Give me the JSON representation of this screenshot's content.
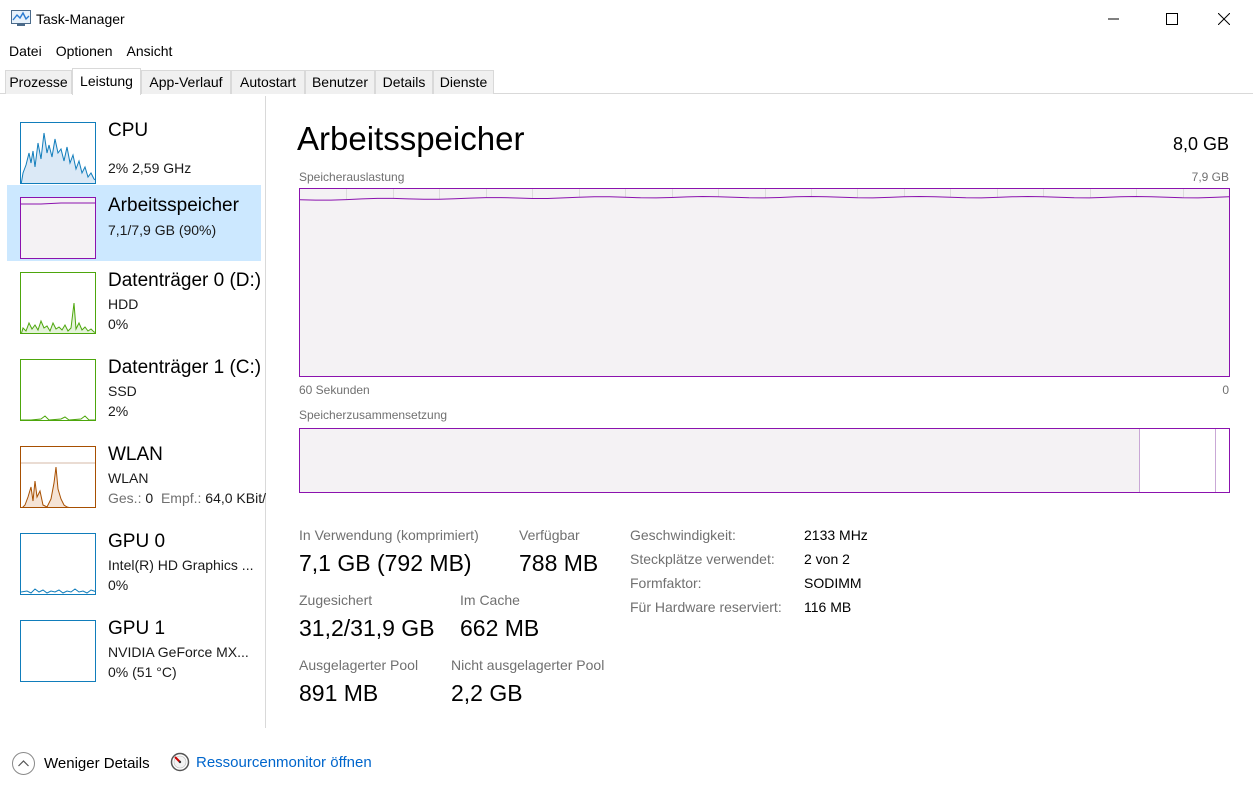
{
  "window": {
    "title": "Task-Manager"
  },
  "menu": [
    "Datei",
    "Optionen",
    "Ansicht"
  ],
  "tabs": [
    {
      "label": "Prozesse"
    },
    {
      "label": "Leistung"
    },
    {
      "label": "App-Verlauf"
    },
    {
      "label": "Autostart"
    },
    {
      "label": "Benutzer"
    },
    {
      "label": "Details"
    },
    {
      "label": "Dienste"
    }
  ],
  "sidebar": [
    {
      "title": "CPU",
      "line1": "2%  2,59 GHz",
      "color": "#117dbb"
    },
    {
      "title": "Arbeitsspeicher",
      "line1": "7,1/7,9 GB (90%)",
      "color": "#8b12ae"
    },
    {
      "title": "Datenträger 0 (D:)",
      "line1": "HDD",
      "line2": "0%",
      "color": "#4da60c"
    },
    {
      "title": "Datenträger 1 (C:)",
      "line1": "SSD",
      "line2": "2%",
      "color": "#4da60c"
    },
    {
      "title": "WLAN",
      "line1": "WLAN",
      "line2_label_a": "Ges.:",
      "line2_val_a": "0",
      "line2_label_b": "Empf.:",
      "line2_val_b": "64,0 KBit/",
      "color": "#a74f01"
    },
    {
      "title": "GPU 0",
      "line1": "Intel(R) HD Graphics ...",
      "line2": "0%",
      "color": "#117dbb"
    },
    {
      "title": "GPU 1",
      "line1": "NVIDIA GeForce MX...",
      "line2": "0%  (51 °C)",
      "color": "#117dbb"
    }
  ],
  "main": {
    "title": "Arbeitsspeicher",
    "total": "8,0 GB",
    "graph_label": "Speicherauslastung",
    "graph_max": "7,9 GB",
    "graph_time_left": "60 Sekunden",
    "graph_time_right": "0",
    "composition_label": "Speicherzusammensetzung",
    "usage_percent": 90
  },
  "stats": {
    "in_use_label": "In Verwendung (komprimiert)",
    "in_use_value": "7,1 GB (792 MB)",
    "available_label": "Verfügbar",
    "available_value": "788 MB",
    "committed_label": "Zugesichert",
    "committed_value": "31,2/31,9 GB",
    "cached_label": "Im Cache",
    "cached_value": "662 MB",
    "paged_label": "Ausgelagerter Pool",
    "paged_value": "891 MB",
    "nonpaged_label": "Nicht ausgelagerter Pool",
    "nonpaged_value": "2,2 GB"
  },
  "properties": [
    {
      "label": "Geschwindigkeit:",
      "value": "2133 MHz"
    },
    {
      "label": "Steckplätze verwendet:",
      "value": "2 von 2"
    },
    {
      "label": "Formfaktor:",
      "value": "SODIMM"
    },
    {
      "label": "Für Hardware reserviert:",
      "value": "116 MB"
    }
  ],
  "footer": {
    "fewer_details": "Weniger Details",
    "resource_monitor": "Ressourcenmonitor öffnen"
  },
  "colors": {
    "memory": "#8b12ae",
    "memory_fill": "#f4f2f4",
    "selection": "#cce8ff",
    "link": "#0066cc"
  }
}
